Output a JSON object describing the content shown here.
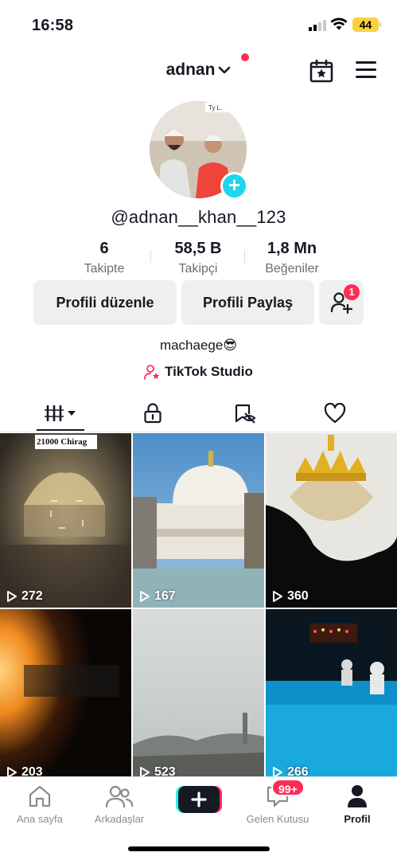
{
  "status_bar": {
    "time": "16:58",
    "battery": "44",
    "icons": [
      "signal-icon",
      "wifi-icon",
      "battery-icon"
    ]
  },
  "header": {
    "username": "adnan",
    "icons": [
      "chevron-down-icon",
      "calendar-star-icon",
      "menu-icon"
    ]
  },
  "profile": {
    "handle": "@adnan__khan__123",
    "stats": [
      {
        "value": "6",
        "label": "Takipte"
      },
      {
        "value": "58,5 B",
        "label": "Takipçi"
      },
      {
        "value": "1,8 Mn",
        "label": "Beğeniler"
      }
    ],
    "edit_label": "Profili düzenle",
    "share_label": "Profili Paylaş",
    "add_friend_badge": "1",
    "bio": "machaege😎",
    "studio_label": "TikTok Studio"
  },
  "tabs": [
    "videos-grid-icon",
    "lock-icon",
    "tagged-hidden-icon",
    "heart-icon"
  ],
  "videos": [
    {
      "views": "272",
      "caption": "21000 Chirag"
    },
    {
      "views": "167"
    },
    {
      "views": "360"
    },
    {
      "views": "203"
    },
    {
      "views": "523"
    },
    {
      "views": "266"
    }
  ],
  "bottom_nav": {
    "items": [
      {
        "label": "Ana sayfa",
        "icon": "home-icon"
      },
      {
        "label": "Arkadaşlar",
        "icon": "friends-icon"
      },
      {
        "label": "",
        "icon": "create-plus-icon"
      },
      {
        "label": "Gelen Kutusu",
        "icon": "inbox-icon"
      },
      {
        "label": "Profil",
        "icon": "profile-icon"
      }
    ],
    "inbox_badge": "99+"
  },
  "colors": {
    "accent_red": "#fe2c55",
    "accent_cyan": "#20d5ec",
    "battery_yellow": "#f7d23e"
  }
}
